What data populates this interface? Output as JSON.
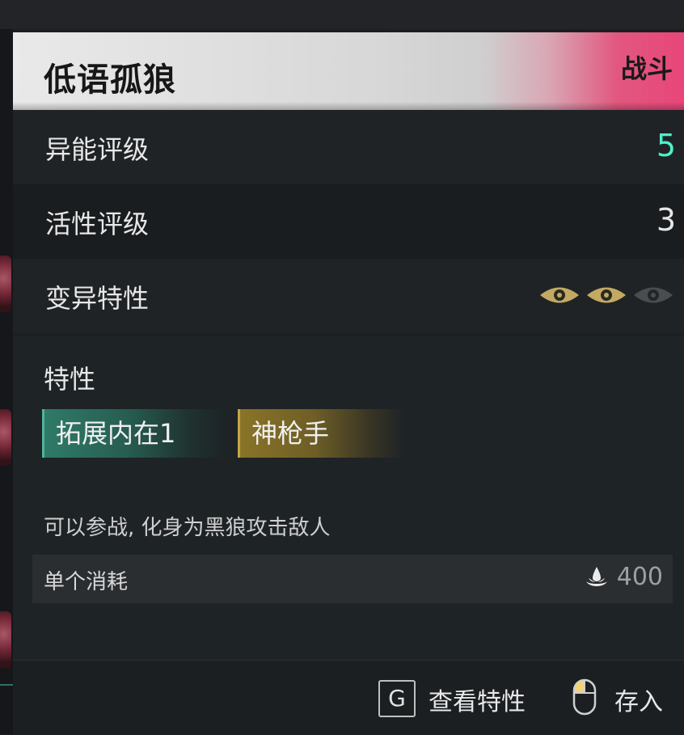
{
  "header": {
    "title": "低语孤狼",
    "tag": "战斗",
    "tag_color": "#e8467a"
  },
  "stats": [
    {
      "label": "异能评级",
      "value": "5",
      "value_color": "#4ef0c8"
    },
    {
      "label": "活性评级",
      "value": "3",
      "value_color": "#e6e6e6"
    },
    {
      "label": "变异特性",
      "eyes": [
        "gold-eye-icon",
        "gold-eye-icon",
        "gray-eye-icon"
      ],
      "filled": 2,
      "total": 3
    }
  ],
  "traits": {
    "title": "特性",
    "chips": [
      {
        "label": "拓展内在1",
        "color": "#2f7a68"
      },
      {
        "label": "神枪手",
        "color": "#8a7428"
      }
    ]
  },
  "description": "可以参战, 化身为黑狼攻击敌人",
  "cost": {
    "label": "单个消耗",
    "icon": "currency-icon",
    "value": "400"
  },
  "footer": {
    "key_g": "G",
    "view_traits": "查看特性",
    "mouse_icon": "mouse-left-click-icon",
    "store": "存入"
  }
}
